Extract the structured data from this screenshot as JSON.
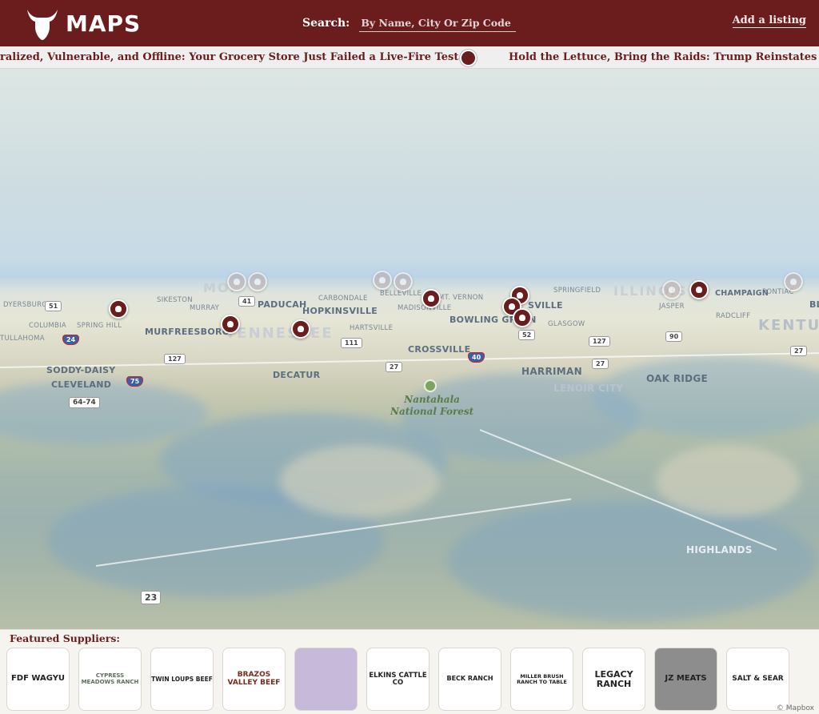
{
  "header": {
    "logo_text": "MAPS",
    "search_label": "Search:",
    "search_placeholder": "By Name, City Or Zip Code",
    "add_listing": "Add a listing"
  },
  "ticker": {
    "items": [
      "ralized, Vulnerable, and Offline: Your Grocery Store Just Failed a Live-Fire Test",
      "Hold the Lettuce, Bring the Raids: Trump Reinstates Immig"
    ]
  },
  "map": {
    "state_labels": [
      "MO.",
      "TENNESSEE",
      "ILLINOIS",
      "KENTUC"
    ],
    "cities": [
      "DYERSBURG",
      "SIKESTON",
      "CARBONDALE",
      "SPRINGFIELD",
      "PONTIAC",
      "MURRAY",
      "PADUCAH",
      "BELLEVILLE",
      "MT. VERNON",
      "MADISONVILLE",
      "HOPKINSVILLE",
      "SVILLE",
      "JASPER",
      "CHAMPAIGN",
      "BLOO",
      "COLUMBIA",
      "SPRING HILL",
      "MURFREESBORO",
      "BOWLING GREEN",
      "GLASGOW",
      "RADCLIFF",
      "TULLAHOMA",
      "HARTSVILLE",
      "CROSSVILLE",
      "SODDY-DAISY",
      "HARRIMAN",
      "DECATUR",
      "OAK RIDGE",
      "CLEVELAND",
      "LENOIR CITY",
      "HIGHLANDS"
    ],
    "highways": [
      "51",
      "41",
      "24",
      "111",
      "127",
      "27",
      "40",
      "52",
      "127",
      "90",
      "27",
      "75",
      "64-74",
      "27",
      "23"
    ],
    "forest_label": "Nantahala\nNational Forest",
    "credit": "© Mapbox"
  },
  "suppliers": {
    "title": "Featured Suppliers:",
    "items": [
      {
        "name": "FDF WAGYU"
      },
      {
        "name": "CYPRESS MEADOWS RANCH"
      },
      {
        "name": "TWIN LOUPS BEEF"
      },
      {
        "name": "BRAZOS VALLEY BEEF"
      },
      {
        "name": ""
      },
      {
        "name": "ELKINS CATTLE CO"
      },
      {
        "name": "BECK RANCH"
      },
      {
        "name": "MILLER BRUSH RANCH TO TABLE"
      },
      {
        "name": "LEGACY RANCH"
      },
      {
        "name": "JZ MEATS"
      },
      {
        "name": "SALT & SEAR"
      }
    ]
  },
  "colors": {
    "brand": "#6b1d1d",
    "ticker_bg": "#efefef"
  }
}
